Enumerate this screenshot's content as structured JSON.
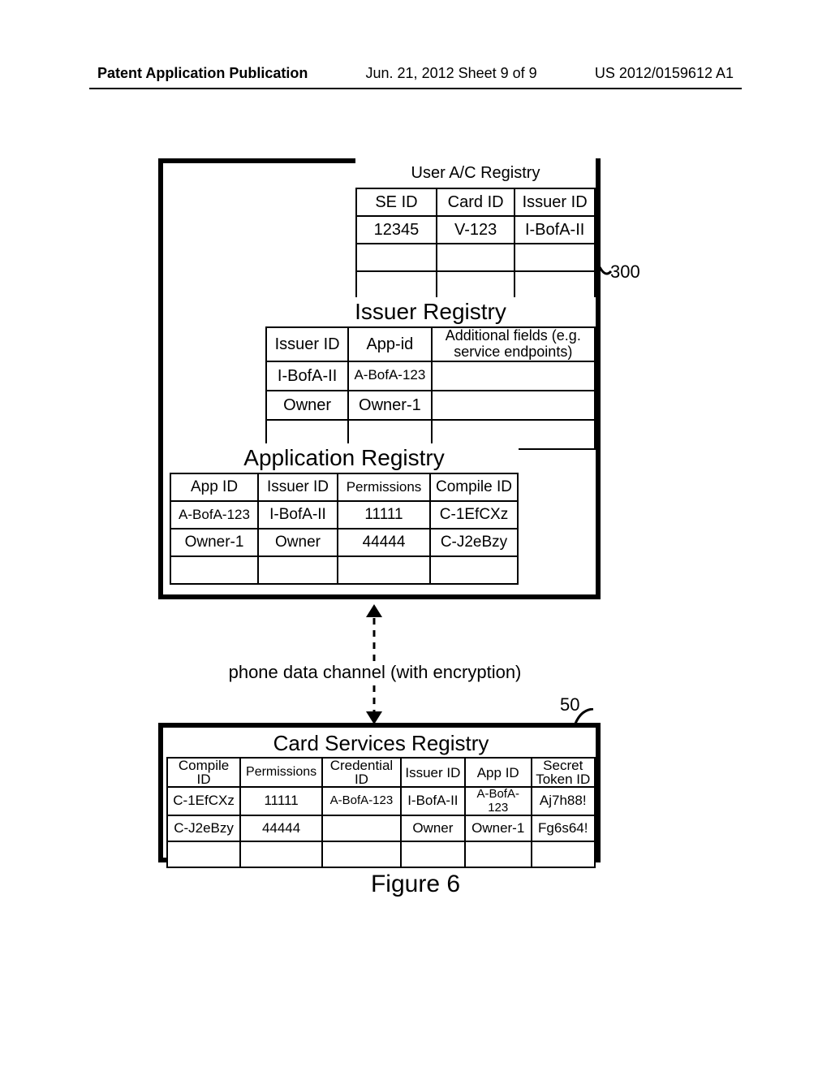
{
  "header": {
    "left": "Patent Application Publication",
    "mid": "Jun. 21, 2012  Sheet 9 of 9",
    "right": "US 2012/0159612 A1"
  },
  "labels": {
    "box300": "300",
    "box50": "50",
    "figure": "Figure 6",
    "channel": "phone data channel (with encryption)"
  },
  "user_registry": {
    "title": "User A/C Registry",
    "headers": [
      "SE ID",
      "Card ID",
      "Issuer ID"
    ],
    "rows": [
      [
        "12345",
        "V-123",
        "I-BofA-II"
      ],
      [
        "",
        "",
        ""
      ],
      [
        "",
        "",
        ""
      ]
    ]
  },
  "issuer_registry": {
    "title": "Issuer Registry",
    "headers": [
      "Issuer ID",
      "App-id",
      "Additional fields (e.g. service endpoints)"
    ],
    "rows": [
      [
        "I-BofA-II",
        "A-BofA-123",
        ""
      ],
      [
        "Owner",
        "Owner-1",
        ""
      ],
      [
        "",
        "",
        ""
      ]
    ]
  },
  "application_registry": {
    "title": "Application Registry",
    "headers": [
      "App ID",
      "Issuer ID",
      "Permissions",
      "Compile ID"
    ],
    "rows": [
      [
        "A-BofA-123",
        "I-BofA-II",
        "11111",
        "C-1EfCXz"
      ],
      [
        "Owner-1",
        "Owner",
        "44444",
        "C-J2eBzy"
      ],
      [
        "",
        "",
        "",
        ""
      ]
    ]
  },
  "card_services_registry": {
    "title": "Card Services Registry",
    "headers": [
      "Compile ID",
      "Permissions",
      "Credential ID",
      "Issuer ID",
      "App ID",
      "Secret Token ID"
    ],
    "rows": [
      [
        "C-1EfCXz",
        "11111",
        "A-BofA-123",
        "I-BofA-II",
        "A-BofA-123",
        "Aj7h88!"
      ],
      [
        "C-J2eBzy",
        "44444",
        "",
        "Owner",
        "Owner-1",
        "Fg6s64!"
      ],
      [
        "",
        "",
        "",
        "",
        "",
        ""
      ]
    ]
  },
  "chart_data": {
    "type": "table",
    "tables": [
      {
        "name": "User A/C Registry",
        "columns": [
          "SE ID",
          "Card ID",
          "Issuer ID"
        ],
        "rows": [
          [
            "12345",
            "V-123",
            "I-BofA-II"
          ]
        ]
      },
      {
        "name": "Issuer Registry",
        "columns": [
          "Issuer ID",
          "App-id",
          "Additional fields (e.g. service endpoints)"
        ],
        "rows": [
          [
            "I-BofA-II",
            "A-BofA-123",
            ""
          ],
          [
            "Owner",
            "Owner-1",
            ""
          ]
        ]
      },
      {
        "name": "Application Registry",
        "columns": [
          "App ID",
          "Issuer ID",
          "Permissions",
          "Compile ID"
        ],
        "rows": [
          [
            "A-BofA-123",
            "I-BofA-II",
            "11111",
            "C-1EfCXz"
          ],
          [
            "Owner-1",
            "Owner",
            "44444",
            "C-J2eBzy"
          ]
        ]
      },
      {
        "name": "Card Services Registry",
        "columns": [
          "Compile ID",
          "Permissions",
          "Credential ID",
          "Issuer ID",
          "App ID",
          "Secret Token ID"
        ],
        "rows": [
          [
            "C-1EfCXz",
            "11111",
            "A-BofA-123",
            "I-BofA-II",
            "A-BofA-123",
            "Aj7h88!"
          ],
          [
            "C-J2eBzy",
            "44444",
            "",
            "Owner",
            "Owner-1",
            "Fg6s64!"
          ]
        ]
      }
    ]
  }
}
